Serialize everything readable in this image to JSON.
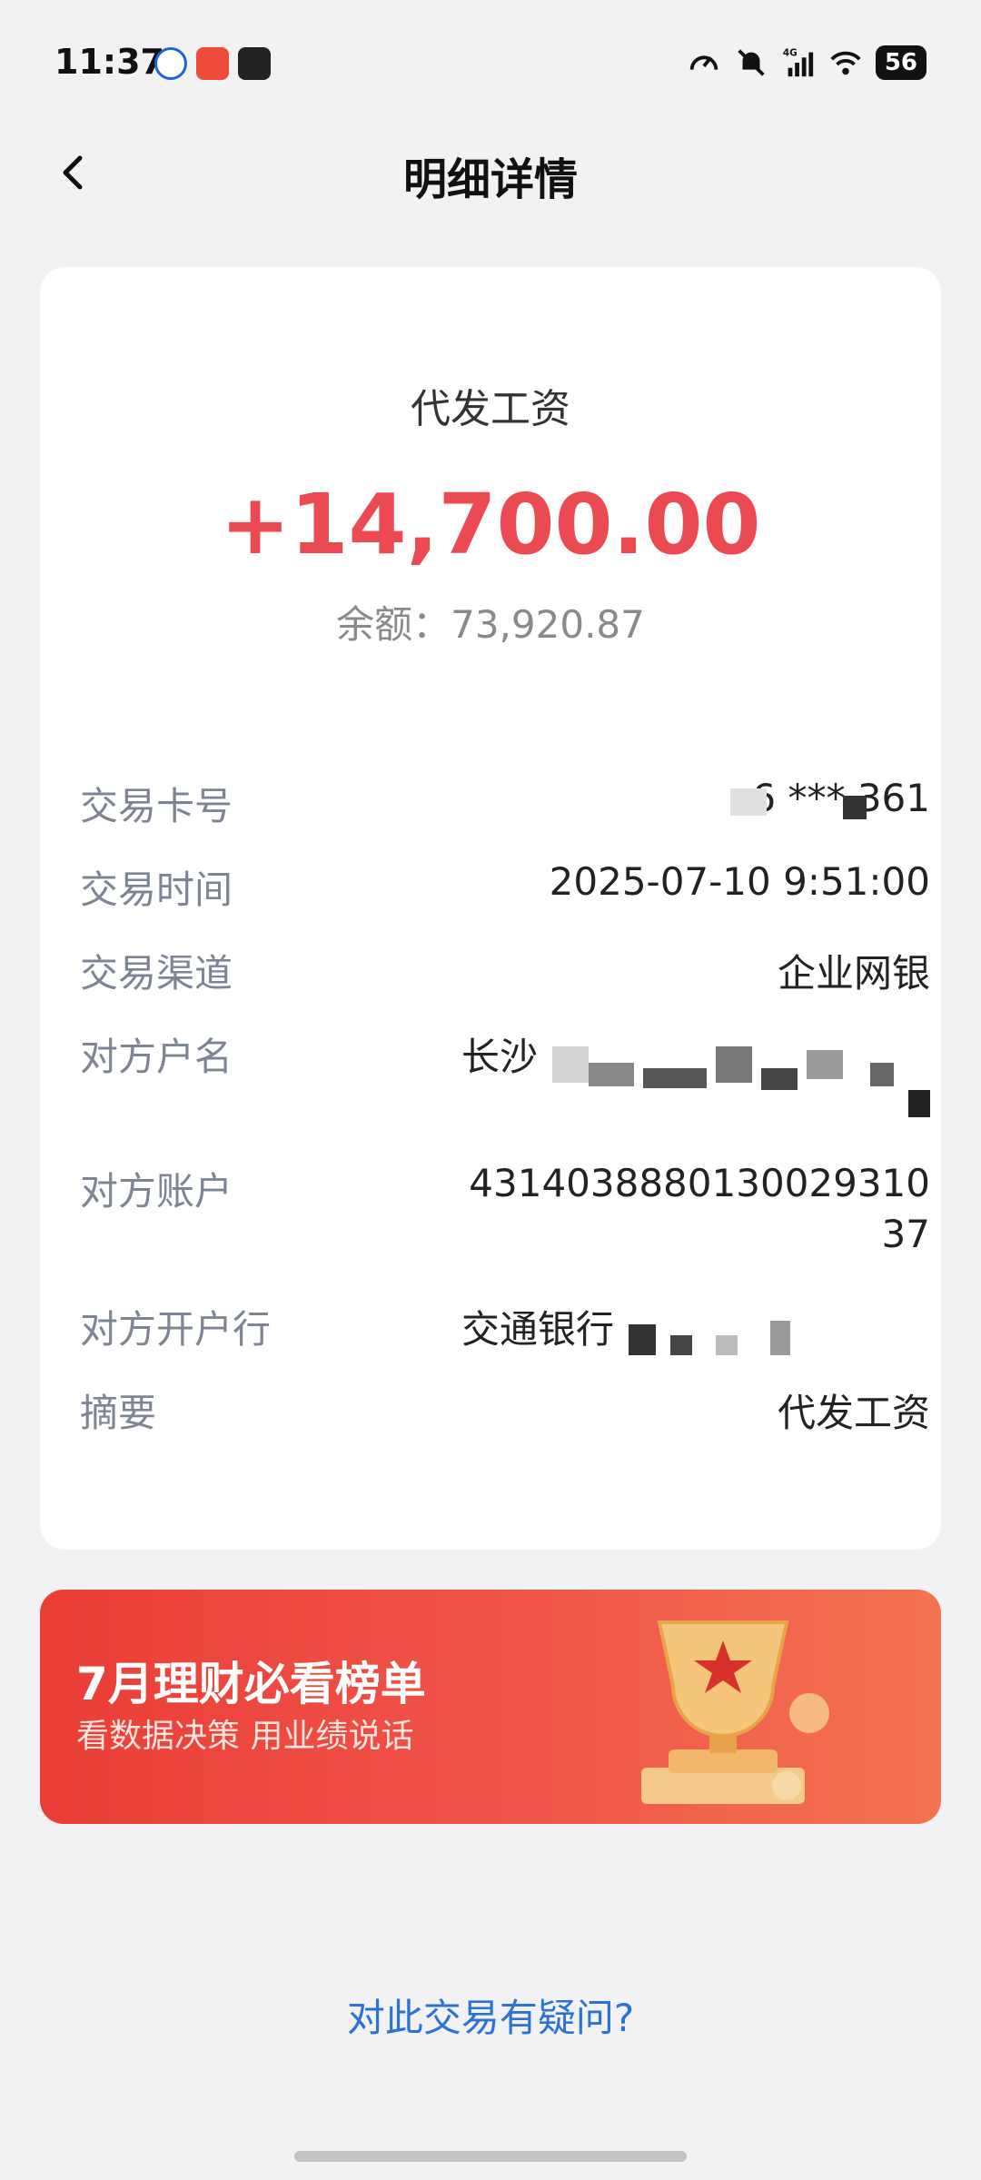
{
  "status_bar": {
    "time": "11:37",
    "battery": "56",
    "network": "4G"
  },
  "nav": {
    "title": "明细详情"
  },
  "transaction": {
    "type": "代发工资",
    "amount": "+14,700.00",
    "balance": "余额：73,920.87"
  },
  "details": [
    {
      "label": "交易卡号",
      "value": "6     ***   361"
    },
    {
      "label": "交易时间",
      "value": "2025-07-10 9:51:00"
    },
    {
      "label": "交易渠道",
      "value": "企业网银"
    },
    {
      "label": "对方户名",
      "value": "长沙"
    },
    {
      "label": "对方账户",
      "value": "4314038880130029310",
      "value2": "37"
    },
    {
      "label": "对方开户行",
      "value": "交通银行"
    },
    {
      "label": "摘要",
      "value": "代发工资"
    }
  ],
  "banner": {
    "title": "7月理财必看榜单",
    "subtitle": "看数据决策 用业绩说话"
  },
  "footer": {
    "question_link": "对此交易有疑问?"
  },
  "colors": {
    "amount": "#ec4a52",
    "link": "#2b72d6",
    "banner": "#ea3d36"
  }
}
